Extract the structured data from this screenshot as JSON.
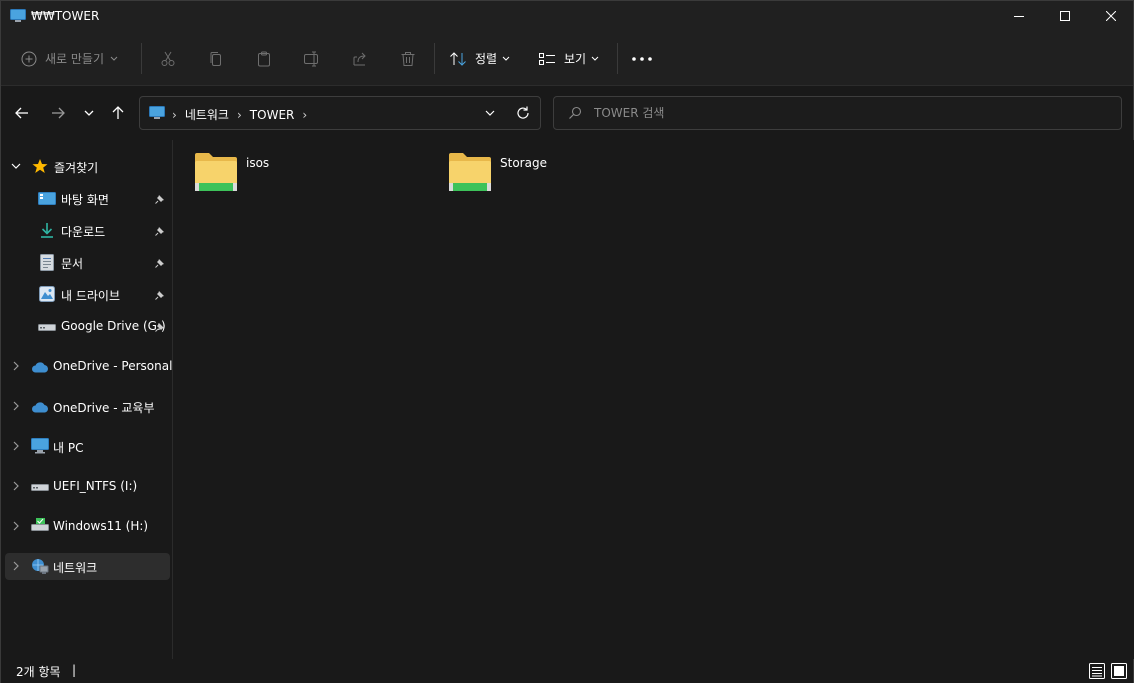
{
  "window": {
    "title": "₩₩TOWER"
  },
  "commandbar": {
    "new_label": "새로 만들기",
    "sort_label": "정렬",
    "view_label": "보기"
  },
  "address": {
    "segments": [
      "네트워크",
      "TOWER"
    ]
  },
  "search": {
    "placeholder": "TOWER 검색"
  },
  "sidebar": {
    "quick_access": {
      "label": "즐겨찾기",
      "items": [
        {
          "label": "바탕 화면",
          "icon": "desktop-icon"
        },
        {
          "label": "다운로드",
          "icon": "download-icon"
        },
        {
          "label": "문서",
          "icon": "documents-icon"
        },
        {
          "label": "내 드라이브",
          "icon": "drive-icon"
        },
        {
          "label": "Google Drive (G:)",
          "icon": "drive-icon"
        }
      ]
    },
    "roots": [
      {
        "label": "OneDrive - Personal",
        "icon": "cloud-icon"
      },
      {
        "label": "OneDrive - 교육부",
        "icon": "cloud-icon"
      },
      {
        "label": "내 PC",
        "icon": "pc-icon"
      },
      {
        "label": "UEFI_NTFS (I:)",
        "icon": "drive-icon"
      },
      {
        "label": "Windows11 (H:)",
        "icon": "drive-icon"
      },
      {
        "label": "네트워크",
        "icon": "network-icon"
      }
    ]
  },
  "content": {
    "folders": [
      {
        "name": "isos"
      },
      {
        "name": "Storage"
      }
    ]
  },
  "status": {
    "count_text": "2개 항목",
    "caret": "|"
  },
  "colors": {
    "accent": "#ffb900",
    "folder_body": "#f7d36b",
    "folder_tab": "#e8b84a",
    "share_green": "#3dc25a",
    "cloud_blue": "#3e8ed0",
    "pc_blue": "#4aa3df"
  }
}
